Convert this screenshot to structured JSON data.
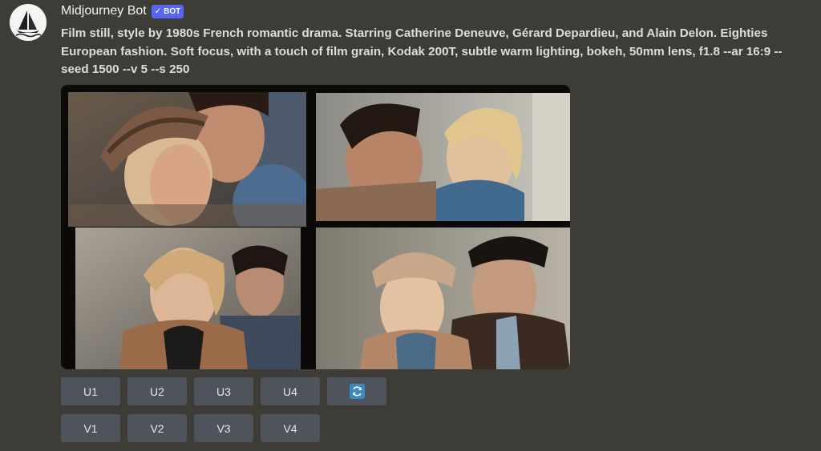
{
  "author": {
    "name": "Midjourney Bot",
    "tag": "BOT",
    "tag_check": "✓"
  },
  "message": {
    "prompt": "Film still, style by 1980s French romantic drama. Starring Catherine Deneuve, Gérard Depardieu, and Alain Delon. Eighties European fashion. Soft focus, with a touch of film grain, Kodak 200T, subtle warm lighting, bokeh, 50mm lens, f1.8 --ar 16:9 --seed 1500 --v 5 --s 250"
  },
  "upscale_buttons": [
    "U1",
    "U2",
    "U3",
    "U4"
  ],
  "variation_buttons": [
    "V1",
    "V2",
    "V3",
    "V4"
  ],
  "icons": {
    "refresh": "refresh-icon",
    "avatar": "sailboat-logo-icon"
  },
  "colors": {
    "background": "#3d3c37",
    "button": "#4f545c",
    "bot_tag": "#5865f2",
    "refresh": "#3b88c3"
  }
}
